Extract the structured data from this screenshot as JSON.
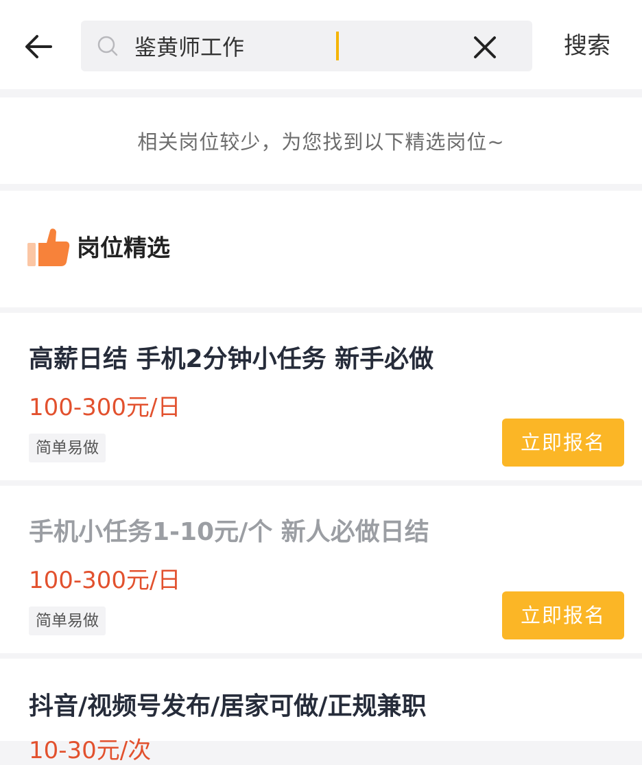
{
  "header": {
    "search_value": "鉴黄师工作",
    "search_button_label": "搜索"
  },
  "notice": {
    "text": "相关岗位较少，为您找到以下精选岗位~"
  },
  "section": {
    "title": "岗位精选"
  },
  "jobs": [
    {
      "title": "高薪日结 手机2分钟小任务 新手必做",
      "salary": "100-300元/日",
      "tag": "简单易做",
      "apply_label": "立即报名"
    },
    {
      "title": "手机小任务1-10元/个 新人必做日结",
      "salary": "100-300元/日",
      "tag": "简单易做",
      "apply_label": "立即报名"
    },
    {
      "title": "抖音/视频号发布/居家可做/正规兼职",
      "salary": "10-30元/次"
    }
  ],
  "colors": {
    "accent": "#fbb626",
    "salary": "#e2512e",
    "thumb_icon": "#f7823a"
  }
}
